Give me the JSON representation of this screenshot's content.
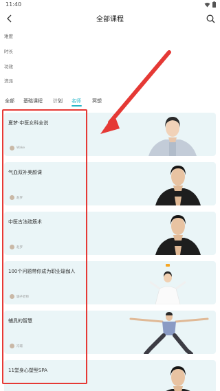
{
  "status_bar": {
    "time": "11:40"
  },
  "header": {
    "title": "全部课程"
  },
  "filters": [
    "难度",
    "时长",
    "功效",
    "流派"
  ],
  "tabs": [
    {
      "label": "全部",
      "active": false
    },
    {
      "label": "基础课程",
      "active": false
    },
    {
      "label": "计划",
      "active": false
    },
    {
      "label": "名师",
      "active": true
    },
    {
      "label": "冥想",
      "active": false
    }
  ],
  "courses": [
    {
      "title": "夏梦·中医女科全说",
      "teacher": "Wake"
    },
    {
      "title": "气血双补美颜课",
      "teacher": "赵罗"
    },
    {
      "title": "中医古法疏筋术",
      "teacher": "赵罗"
    },
    {
      "title": "100个问题带你成为职业瑜伽人",
      "teacher": "瑜子老师"
    },
    {
      "title": "辅具的智慧",
      "teacher": "冯璟"
    },
    {
      "title": "11堂身心塑型SPA",
      "teacher": ""
    }
  ],
  "colors": {
    "accent": "#27b6c9",
    "annotation": "#e53935",
    "card_bg": "#eaf5f7"
  }
}
